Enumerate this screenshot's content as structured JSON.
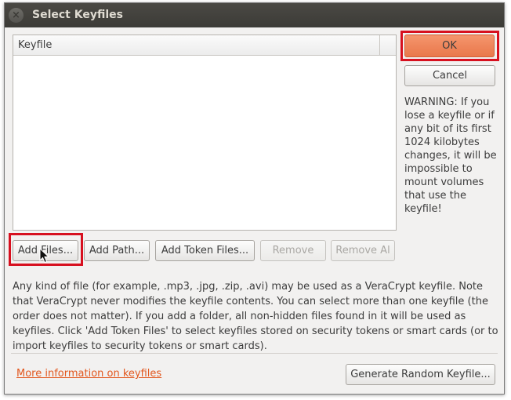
{
  "window": {
    "title": "Select Keyfiles"
  },
  "keyfile_list": {
    "column_header": "Keyfile"
  },
  "buttons": {
    "ok": "OK",
    "cancel": "Cancel",
    "add_files": "Add Files...",
    "add_path": "Add Path...",
    "add_token_files": "Add Token Files...",
    "remove": "Remove",
    "remove_all": "Remove Al",
    "generate_random": "Generate Random Keyfile..."
  },
  "warning_text": "WARNING: If you lose a keyfile or if any bit of its first 1024 kilobytes changes, it will be impossible to mount volumes that use the keyfile!",
  "description": "Any kind of file (for example, .mp3, .jpg, .zip, .avi) may be used as a VeraCrypt keyfile. Note that VeraCrypt never modifies the keyfile contents. You can select more than one keyfile (the order does not matter). If you add a folder, all non-hidden files found in it will be used as keyfiles. Click 'Add Token Files' to select keyfiles stored on security tokens or smart cards (or to import keyfiles to security tokens or smart cards).",
  "more_info_link": "More information on keyfiles",
  "icons": {
    "close": "close-icon",
    "cursor": "mouse-pointer-icon"
  },
  "colors": {
    "highlight": "#d7101f",
    "ok_button": "#ef8559",
    "link": "#e2571e",
    "titlebar": "#3c3b37"
  }
}
